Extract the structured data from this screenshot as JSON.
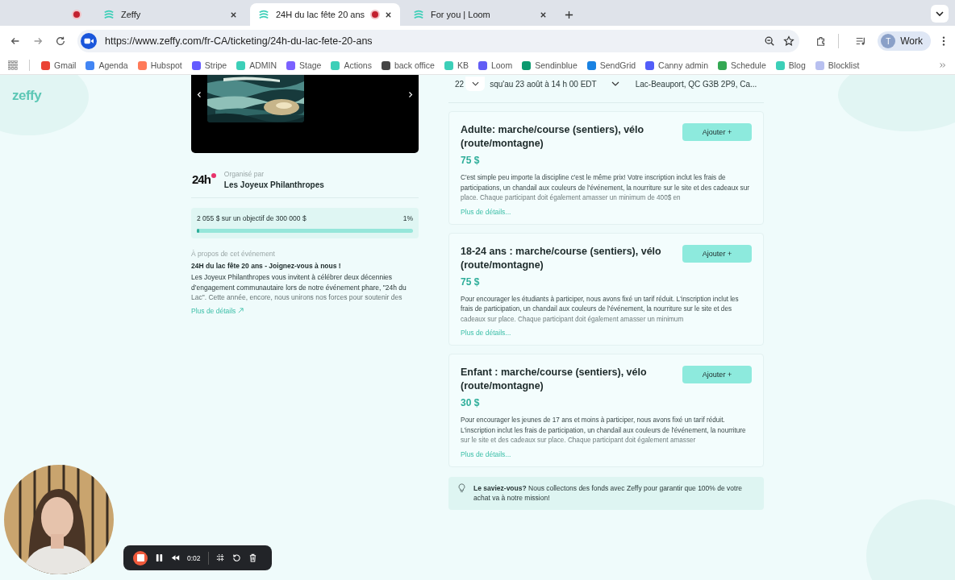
{
  "browser": {
    "tabs": [
      {
        "kind": "pinned",
        "recording": true,
        "selected": false
      },
      {
        "kind": "normal",
        "title": "Zeffy",
        "recording": false,
        "selected": false
      },
      {
        "kind": "normal",
        "title": "24H du lac fête 20 ans",
        "recording": true,
        "selected": true
      },
      {
        "kind": "normal",
        "title": "For you | Loom",
        "recording": false,
        "selected": false
      }
    ],
    "url": "https://www.zeffy.com/fr-CA/ticketing/24h-du-lac-fete-20-ans",
    "profile": {
      "initial": "T",
      "label": "Work"
    },
    "bookmarks": [
      {
        "label": "Gmail",
        "color": "#ea4335"
      },
      {
        "label": "Agenda",
        "color": "#4285f4"
      },
      {
        "label": "Hubspot",
        "color": "#ff7a59"
      },
      {
        "label": "Stripe",
        "color": "#635bff"
      },
      {
        "label": "ADMIN",
        "color": "#3ccfb8"
      },
      {
        "label": "Stage",
        "color": "#7b61ff"
      },
      {
        "label": "Actions",
        "color": "#3ccfb8"
      },
      {
        "label": "back office",
        "color": "#444444"
      },
      {
        "label": "KB",
        "color": "#3ccfb8"
      },
      {
        "label": "Loom",
        "color": "#625df5"
      },
      {
        "label": "Sendinblue",
        "color": "#0b996e"
      },
      {
        "label": "SendGrid",
        "color": "#1a82e2"
      },
      {
        "label": "Canny admin",
        "color": "#525df9"
      },
      {
        "label": "Schedule",
        "color": "#34a853"
      },
      {
        "label": "Blog",
        "color": "#3ccfb8"
      },
      {
        "label": "Blocklist",
        "color": "#b8c0f0"
      }
    ]
  },
  "page": {
    "logo": "zeffy",
    "organizer": {
      "logo_text": "24h",
      "caption": "Organisé par",
      "name": "Les Joyeux Philanthropes"
    },
    "goal": {
      "text": "2 055 $ sur un objectif de 300 000 $",
      "percent": "1%",
      "level": 0.01
    },
    "about": {
      "heading": "À propos de cet événement",
      "title": "24H du lac fête 20 ans - Joignez-vous à nous !",
      "text": "Les Joyeux Philanthropes vous invitent à célébrer deux décennies d’engagement communautaire lors de notre événement phare, \"24h du Lac\". Cette année, encore, nous unirons nos forces pour soutenir des",
      "link": "Plus de détails"
    },
    "event_info": {
      "day": "22",
      "dates": "squ'au 23 août à 14 h 00 EDT",
      "location": "Lac-Beauport, QC G3B 2P9, Ca..."
    },
    "tickets": [
      {
        "name": "Adulte: marche/course (sentiers), vélo (route/montagne)",
        "price": "75 $",
        "description": "C'est simple peu importe la discipline c'est le même prix! Votre inscription inclut les frais de participations, un chandail aux couleurs de l'événement, la nourriture sur le site et des cadeaux sur place. Chaque participant doit également amasser un minimum de 400$ en",
        "link": "Plus de détails...",
        "button": "Ajouter +"
      },
      {
        "name": "18-24 ans : marche/course (sentiers), vélo (route/montagne)",
        "price": "75 $",
        "description": "Pour encourager les étudiants à participer, nous avons fixé un tarif réduit. L'inscription inclut les frais de participation, un chandail aux couleurs de l'événement, la nourriture sur le site et des cadeaux sur place. Chaque participant doit également amasser un minimum",
        "link": "Plus de détails...",
        "button": "Ajouter +"
      },
      {
        "name": "Enfant : marche/course (sentiers), vélo (route/montagne)",
        "price": "30 $",
        "description": "Pour encourager les jeunes de 17 ans et moins à participer, nous avons fixé un tarif réduit. L'inscription inclut les frais de participation, un chandail aux couleurs de l'événement, la nourriture sur le site et des cadeaux sur place. Chaque participant doit également amasser",
        "link": "Plus de détails...",
        "button": "Ajouter +"
      }
    ],
    "tip": {
      "text": "**Le saviez-vous?** Nous collectons des fonds avec Zeffy pour garantir que 100% de votre achat va à notre mission!"
    }
  },
  "recorder": {
    "time": "0:02"
  }
}
